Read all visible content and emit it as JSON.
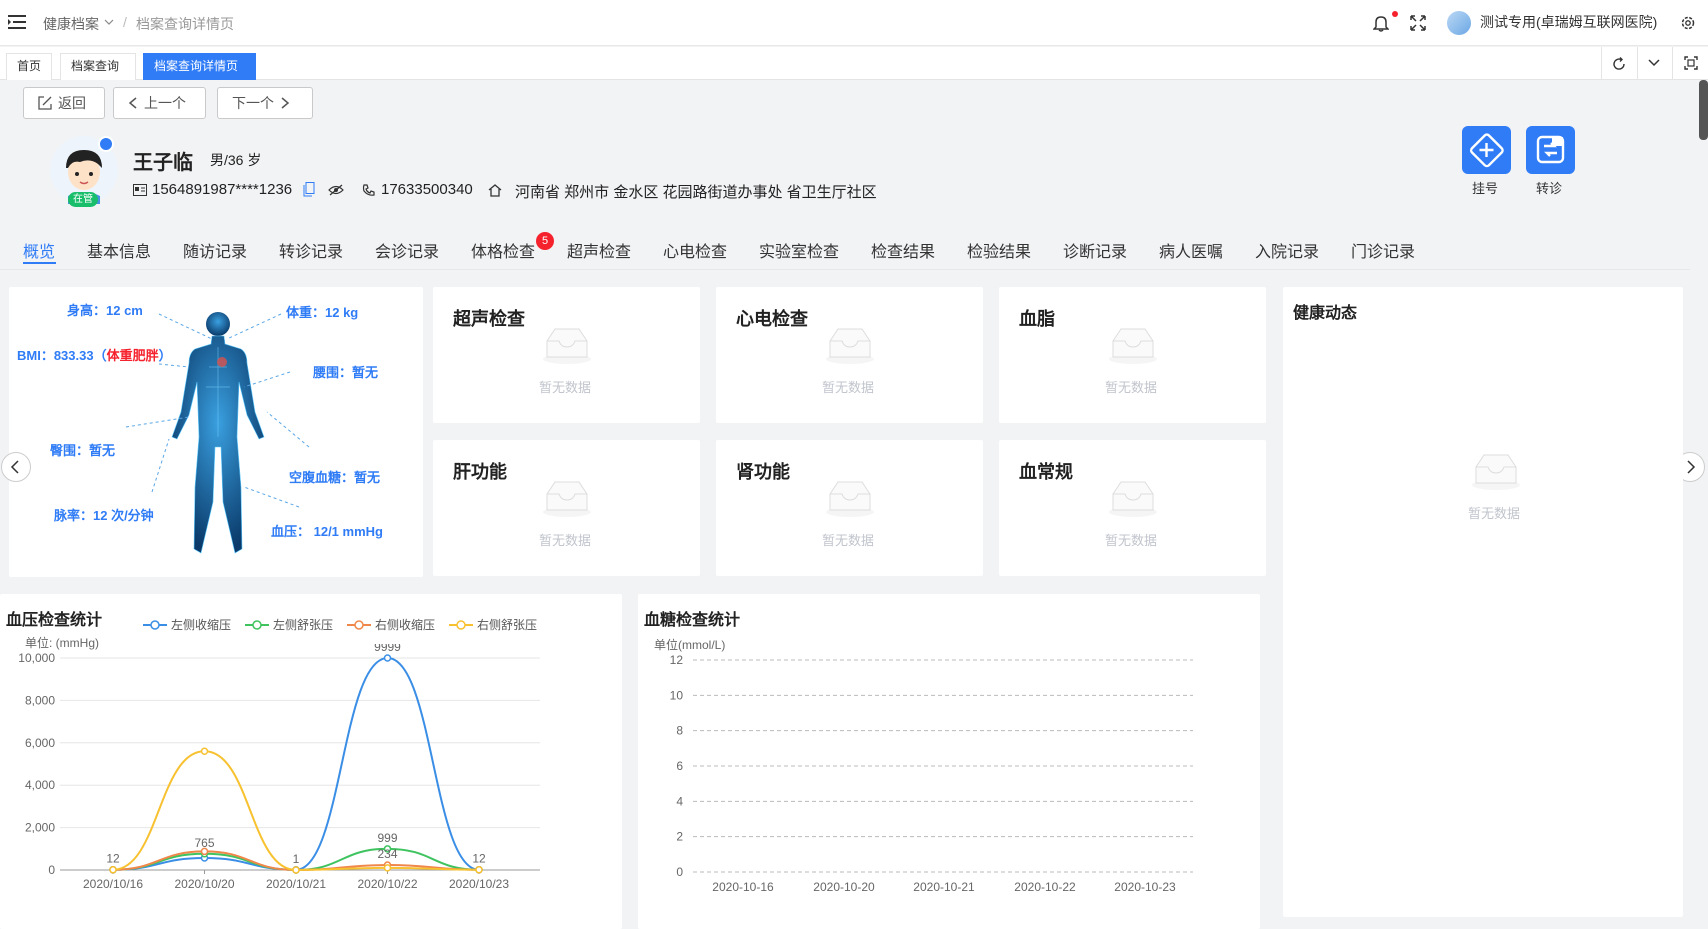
{
  "header": {
    "breadcrumb": [
      "健康档案",
      "档案查询详情页"
    ],
    "user": "测试专用(卓瑞姆互联网医院)"
  },
  "tabs": [
    {
      "label": "首页"
    },
    {
      "label": "档案查询"
    },
    {
      "label": "档案查询详情页",
      "close": "×"
    }
  ],
  "toolbar": {
    "back": "返回",
    "prev": "上一个",
    "next": "下一个"
  },
  "patient": {
    "name": "王子临",
    "gender_age": "男/36 岁",
    "id_number": "1564891987****1236",
    "phone": "17633500340",
    "address": "河南省 郑州市 金水区 花园路街道办事处 省卫生厅社区",
    "status_badge": "在管"
  },
  "actions": {
    "register": "挂号",
    "transfer": "转诊"
  },
  "subnav": [
    "概览",
    "基本信息",
    "随访记录",
    "转诊记录",
    "会诊记录",
    "体格检查",
    "超声检查",
    "心电检查",
    "实验室检查",
    "检查结果",
    "检验结果",
    "诊断记录",
    "病人医嘱",
    "入院记录",
    "门诊记录"
  ],
  "subnav_badge": "5",
  "body_metrics": {
    "height": "身高：12 cm",
    "weight": "体重：12 kg",
    "bmi": "BMI：833.33",
    "bmi_status_open": "（",
    "bmi_status": "体重肥胖",
    "bmi_status_close": "）",
    "waist": "腰围：暂无",
    "hip": "臀围：暂无",
    "glucose": "空腹血糖：暂无",
    "pulse": "脉率：12 次/分钟",
    "bp": "血压：  12/1 mmHg"
  },
  "cards": [
    "超声检查",
    "心电检查",
    "血脂",
    "肝功能",
    "肾功能",
    "血常规"
  ],
  "empty_text": "暂无数据",
  "health_feed": {
    "title": "健康动态"
  },
  "colors": {
    "primary": "#2f7cf6",
    "danger": "#f5222d",
    "series_blue": "#3a8ee6",
    "series_green": "#3fc35f",
    "series_orange": "#f0874a",
    "series_yellow": "#f7c130"
  },
  "chart_data": [
    {
      "type": "line",
      "title": "血压检查统计",
      "ylabel": "单位: (mmHg)",
      "categories": [
        "2020/10/16",
        "2020/10/20",
        "2020/10/21",
        "2020/10/22",
        "2020/10/23"
      ],
      "ylim": [
        0,
        10000
      ],
      "yticks": [
        "0",
        "2,000",
        "4,000",
        "6,000",
        "8,000",
        "10,000"
      ],
      "legend_position": "top",
      "smooth": true,
      "series": [
        {
          "name": "左侧收缩压",
          "values": [
            12,
            565,
            12,
            9999,
            12
          ],
          "labels": [
            "",
            "",
            "",
            "9999",
            ""
          ]
        },
        {
          "name": "左侧舒张压",
          "values": [
            12,
            765,
            1,
            999,
            12
          ],
          "labels": [
            "",
            "765",
            "",
            "999",
            "12"
          ]
        },
        {
          "name": "右侧收缩压",
          "values": [
            12,
            876,
            1,
            234,
            12
          ],
          "labels": [
            "12",
            "",
            "1",
            "234",
            ""
          ]
        },
        {
          "name": "右侧舒张压",
          "values": [
            12,
            5600,
            1,
            100,
            12
          ],
          "labels": [
            "",
            "",
            "",
            "",
            ""
          ]
        }
      ]
    },
    {
      "type": "line",
      "title": "血糖检查统计",
      "ylabel": "单位(mmol/L)",
      "categories": [
        "2020-10-16",
        "2020-10-20",
        "2020-10-21",
        "2020-10-22",
        "2020-10-23"
      ],
      "ylim": [
        0,
        12
      ],
      "yticks": [
        "0",
        "2",
        "4",
        "6",
        "8",
        "10",
        "12"
      ],
      "grid": "dashed",
      "series": []
    }
  ]
}
